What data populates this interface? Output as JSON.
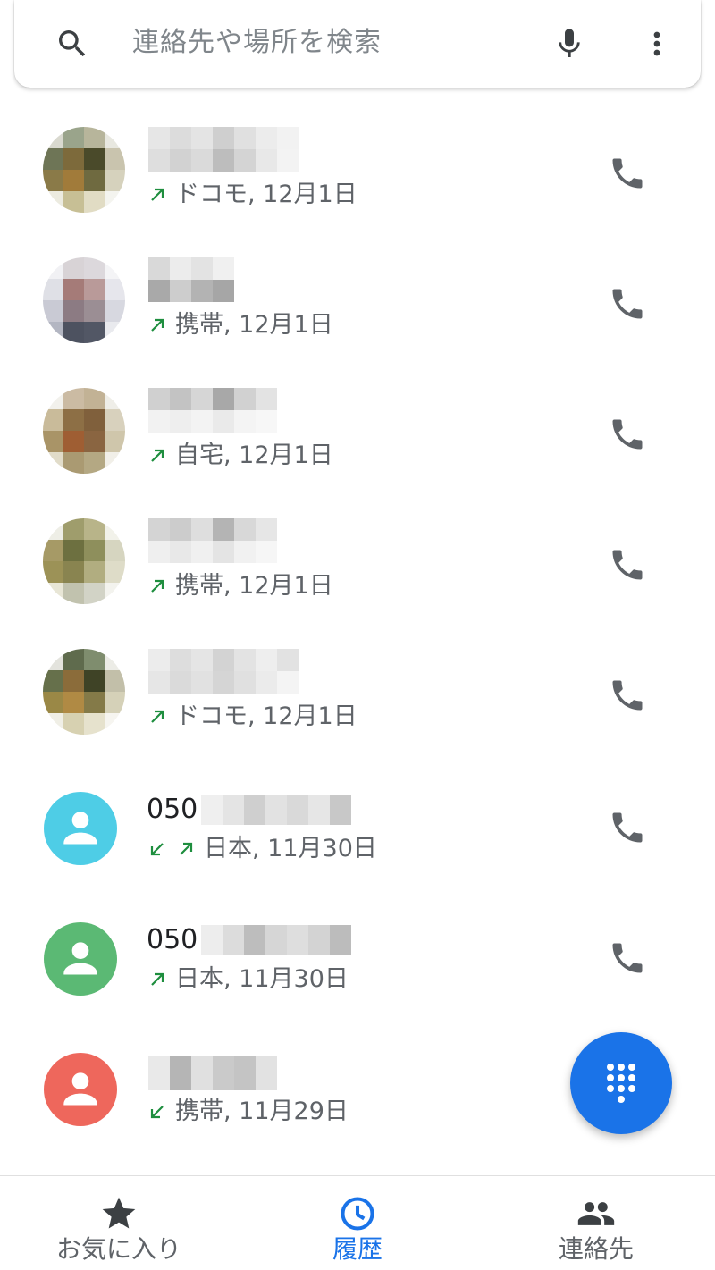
{
  "search": {
    "placeholder": "連絡先や場所を検索",
    "search_icon": "search-icon",
    "mic_icon": "mic-icon",
    "more_icon": "more-vert-icon"
  },
  "calls": [
    {
      "detail": "ドコモ, 12月1日",
      "directions": [
        "outgoing"
      ],
      "avatar": "photo"
    },
    {
      "detail": "携帯, 12月1日",
      "directions": [
        "outgoing"
      ],
      "avatar": "photo"
    },
    {
      "detail": "自宅, 12月1日",
      "directions": [
        "outgoing"
      ],
      "avatar": "photo"
    },
    {
      "detail": "携帯, 12月1日",
      "directions": [
        "outgoing"
      ],
      "avatar": "photo"
    },
    {
      "detail": "ドコモ, 12月1日",
      "directions": [
        "outgoing"
      ],
      "avatar": "photo"
    },
    {
      "number_prefix": "050",
      "detail": "日本, 11月30日",
      "directions": [
        "incoming",
        "outgoing"
      ],
      "avatar": "generic",
      "avatar_color": "#4ecde6"
    },
    {
      "number_prefix": "050",
      "detail": "日本, 11月30日",
      "directions": [
        "outgoing"
      ],
      "avatar": "generic",
      "avatar_color": "#5bb974"
    },
    {
      "detail": "携帯, 11月29日",
      "directions": [
        "incoming"
      ],
      "avatar": "generic",
      "avatar_color": "#ee675c"
    }
  ],
  "fab": {
    "icon": "dialpad-icon"
  },
  "nav": {
    "favorites": "お気に入り",
    "recents": "履歴",
    "contacts": "連絡先",
    "active": "recents"
  },
  "colors": {
    "accent": "#1a73e8",
    "call_direction": "#1e8e3e",
    "call_icon": "#5f6368"
  }
}
